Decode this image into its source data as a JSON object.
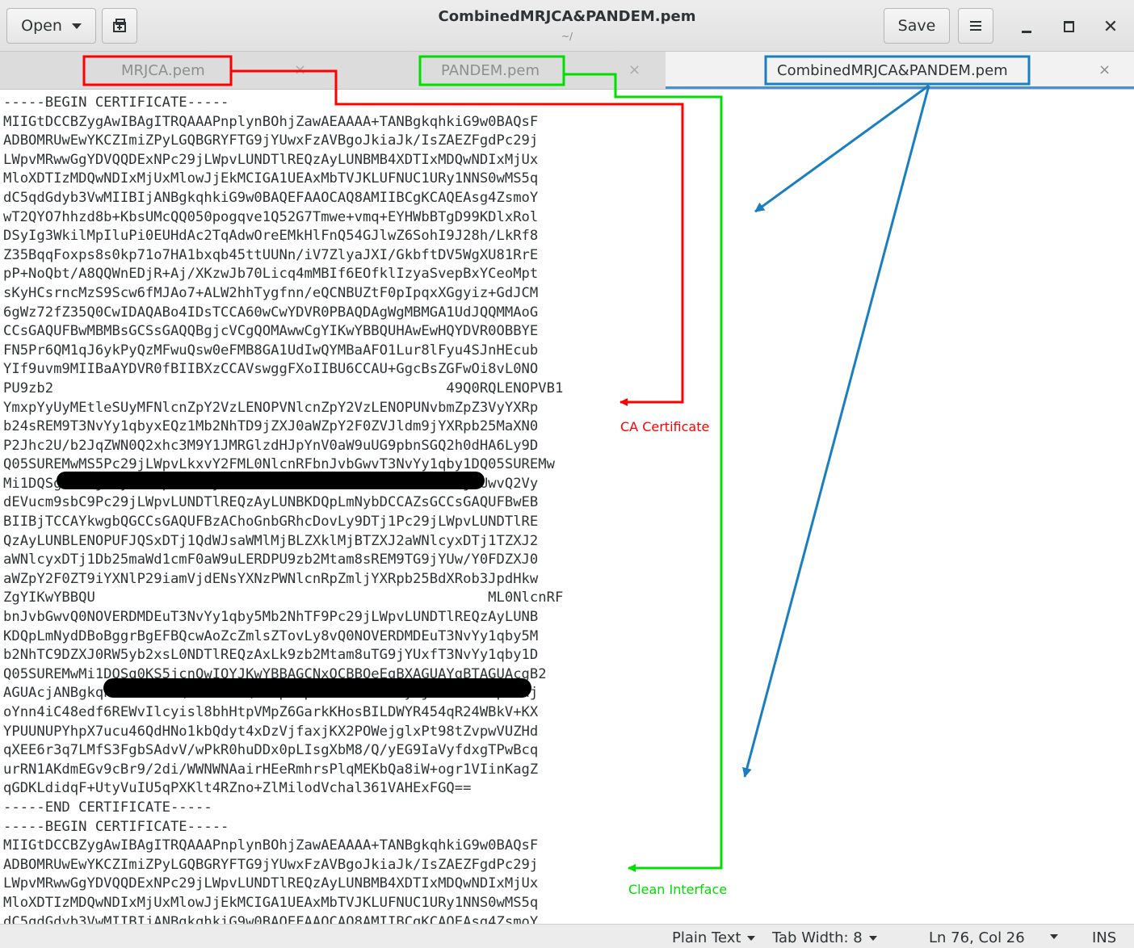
{
  "header": {
    "open_label": "Open",
    "title": "CombinedMRJCA&PANDEM.pem",
    "subtitle": "~/",
    "save_label": "Save"
  },
  "tabs": [
    {
      "label": "MRJCA.pem",
      "close": "×"
    },
    {
      "label": "PANDEM.pem",
      "close": "×"
    },
    {
      "label": "CombinedMRJCA&PANDEM.pem",
      "close": "×"
    }
  ],
  "editor": {
    "lines": [
      "-----BEGIN CERTIFICATE-----",
      "MIIGtDCCBZygAwIBAgITRQAAAPnplynBOhjZawAEAAAA+TANBgkqhkiG9w0BAQsF",
      "ADBOMRUwEwYKCZImiZPyLGQBGRYFTG9jYUwxFzAVBgoJkiaJk/IsZAEZFgdPc29j",
      "LWpvMRwwGgYDVQQDExNPc29jLWpvLUNDTlREQzAyLUNBMB4XDTIxMDQwNDIxMjUx",
      "MloXDTIzMDQwNDIxMjUxMlowJjEkMCIGA1UEAxMbTVJKLUFNUC1URy1NNS0wMS5q",
      "dC5qdGdyb3VwMIIBIjANBgkqhkiG9w0BAQEFAAOCAQ8AMIIBCgKCAQEAsg4ZsmoY",
      "wT2QYO7hhzd8b+KbsUMcQQ050pogqve1Q52G7Tmwe+vmq+EYHWbBTgD99KDlxRol",
      "DSyIg3WkilMpIluPi0EUHdAc2TqAdwOreEMkHlFnQ54GJlwZ6SohI9J28h/LkRf8",
      "Z35BqqFoxps8s0kp71o7HA1bxqb45ttUUNn/iV7ZlyaJXI/GkbftDV5WgXU81RrE",
      "pP+NoQbt/A8QQWnEDjR+Aj/XKzwJb70Licq4mMBIf6EOfklIzyaSvepBxYCeoMpt",
      "sKyHCsrncMzS9Scw6fMJAo7+ALW2hhTygfnn/eQCNBUZtF0pIpqxXGgyiz+GdJCM",
      "6gWz72fZ35Q0CwIDAQABo4IDsTCCA60wCwYDVR0PBAQDAgWgMBMGA1UdJQQMMAoG",
      "CCsGAQUFBwMBMBsGCSsGAQQBgjcVCgQOMAwwCgYIKwYBBQUHAwEwHQYDVR0OBBYE",
      "FN5Pr6QM1qJ6ykPyQzMFwuQsw0eFMB8GA1UdIwQYMBaAFO1Lur8lFyu4SJnHEcub",
      "YIf9uvm9MIIBaAYDVR0fBIIBXzCCAVswggFXoIIBU6CCAU+GgcBsZGFwOi8vL0NO",
      "PU9zb2                                               49Q0RQLENOPVB1",
      "YmxpYyUyMEtleSUyMFNlcnZpY2VzLENOPVNlcnZpY2VzLENOPUNvbmZpZ3VyYXRp",
      "b24sREM9T3NvYy1qbyxEQz1Mb2NhTD9jZXJ0aWZpY2F0ZVJldm9jYXRpb25MaXN0",
      "P2Jhc2U/b2JqZWN0Q2xhc3M9Y1JMRGlzdHJpYnV0aW9uUG9pbnSGQ2h0dHA6Ly9D",
      "Q05SUREMwMS5Pc29jLWpvLkxvY2FML0NlcnRFbnJvbGwvT3NvYy1qby1DQ05SUREMw",
      "Mi1DQSg0KS5jcmyGRWZpbGU6Ly8vL0NDTlREQzAxLk9zb2Mtam8uTG9jYUwvQ2Vy",
      "dEVucm9sbC9Pc29jLWpvLUNDTlREQzAyLUNBKDQpLmNybDCCAZsGCCsGAQUFBwEB",
      "BIIBjTCCAYkwgbQGCCsGAQUFBzAChoGnbGRhcDovLy9DTj1Pc29jLWpvLUNDTlRE",
      "QzAyLUNBLENOPUFJQSxDTj1QdWJsaWMlMjBLZXklMjBTZXJ2aWNlcyxDTj1TZXJ2",
      "aWNlcyxDTj1Db25maWd1cmF0aW9uLERDPU9zb2Mtam8sREM9TG9jYUw/Y0FDZXJ0",
      "aWZpY2F0ZT9iYXNlP29iamVjdENsYXNzPWNlcnRpZmljYXRpb25BdXRob3JpdHkw",
      "ZgYIKwYBBQU                                               ML0NlcnRF",
      "bnJvbGwvQ0NOVERDMDEuT3NvYy1qby5Mb2NhTF9Pc29jLWpvLUNDTlREQzAyLUNB",
      "KDQpLmNydDBoBggrBgEFBQcwAoZcZmlsZTovLy8vQ0NOVERDMDEuT3NvYy1qby5M",
      "b2NhTC9DZXJ0RW5yb2xsL0NDTlREQzAxLk9zb2Mtam8uTG9jYUxfT3NvYy1qby1D",
      "Q05SUREMwMi1DQSg0KS5jcnQwIQYJKwYBBAGCNxQCBBQeEgBXAGUAYgBTAGUAcgB2",
      "AGUAcjANBgkqhkiG9w0BAQsFAAOCAQEAOpiMp5U82+HHoc9zy7jzakEONXMptvhj",
      "oYnn4iC48edf6REWvIlcyisl8bhHtpVMpZ6GarkKHosBILDWYR454qR24WBkV+KX",
      "YPUUNUPYhpX7ucu46QdHNo1kbQdyt4xDzVjfaxjKX2POWejglxPt98tZvpwVUZHd",
      "qXEE6r3q7LMfS3FgbSAdvV/wPkR0huDDx0pLIsgXbM8/Q/yEG9IaVyfdxgTPwBcq",
      "urRN1AKdmEGv9cBr9/2di/WWNWNAairHEeRmhrsPlqMEKbQa8iW+ogr1VIinKagZ",
      "qGDKLdidqF+UtyVuIU5qPXKlt4RZno+ZlMilodVchal361VAHExFGQ==",
      "-----END CERTIFICATE-----",
      "-----BEGIN CERTIFICATE-----",
      "MIIGtDCCBZygAwIBAgITRQAAAPnplynBOhjZawAEAAAA+TANBgkqhkiG9w0BAQsF",
      "ADBOMRUwEwYKCZImiZPyLGQBGRYFTG9jYUwxFzAVBgoJkiaJk/IsZAEZFgdPc29j",
      "LWpvMRwwGgYDVQQDExNPc29jLWpvLUNDTlREQzAyLUNBMB4XDTIxMDQwNDIxMjUx",
      "MloXDTIzMDQwNDIxMjUxMlowJjEkMCIGA1UEAxMbTVJKLUFNUC1URy1NNS0wMS5q",
      "dC5qdGdyb3VwMIIBIjANBgkqhkiG9w0BAQEFAAOCAQ8AMIIBCgKCAQEAsg4ZsmoY"
    ]
  },
  "annotations": {
    "ca_label": "CA Certificate",
    "clean_label": "Clean Interface",
    "colors": {
      "red": "#ff0000",
      "green": "#00dd00",
      "blue": "#1a7fc0"
    }
  },
  "status": {
    "syntax": "Plain Text",
    "tab_width": "Tab Width: 8",
    "position": "Ln 76, Col 26",
    "mode": "INS"
  }
}
